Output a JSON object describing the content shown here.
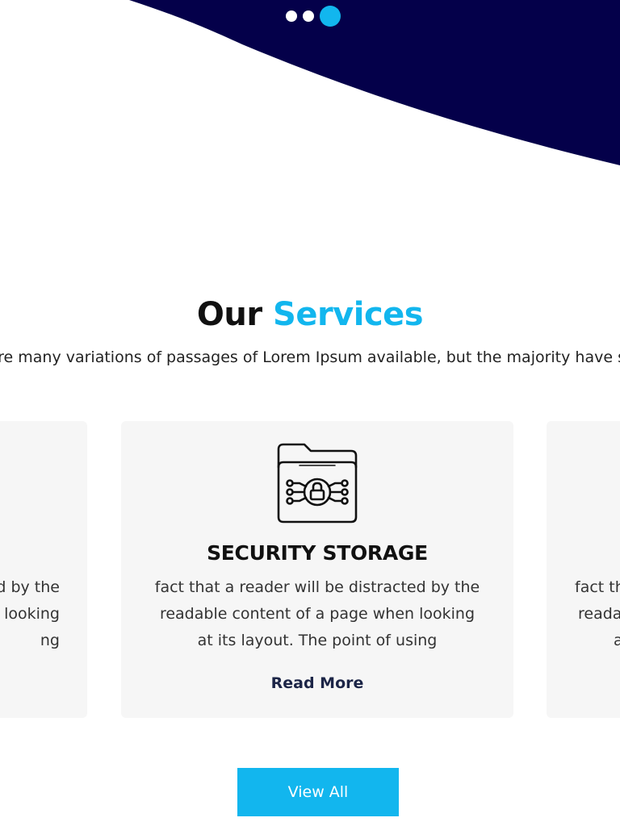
{
  "colors": {
    "navy": "#04004a",
    "accent": "#12b6ee",
    "card_bg": "#f6f6f6",
    "link": "#1c2547"
  },
  "carousel": {
    "dots": [
      {
        "active": false
      },
      {
        "active": false
      },
      {
        "active": true
      }
    ]
  },
  "services": {
    "title_dark": "Our",
    "title_accent": "Services",
    "description": "There are many variations of passages of Lorem Ipsum available, but the majority have suffered"
  },
  "cards": [
    {
      "position": "left",
      "icon": "partial-icon",
      "title": "",
      "lines": [
        "d by the",
        "looking",
        "ng"
      ],
      "link": ""
    },
    {
      "position": "center",
      "icon": "secure-folder-lock-icon",
      "title": "SECURITY STORAGE",
      "lines": [
        "fact that a reader will be distracted by the",
        "readable content of a page when looking",
        "at its layout. The point of using"
      ],
      "link": "Read More"
    },
    {
      "position": "right",
      "icon": "partial-icon",
      "title": "",
      "lines": [
        "fact th",
        "reada",
        "a"
      ],
      "link": ""
    }
  ],
  "view_all": {
    "label": "View All"
  }
}
